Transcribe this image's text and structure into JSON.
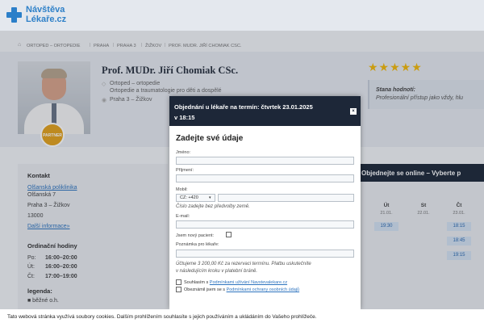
{
  "header": {
    "logo_line1": "Návštěva",
    "logo_line2": "Lékaře.cz"
  },
  "breadcrumb": [
    "ORTOPED – ORTOPEDIE",
    "PRAHA",
    "PRAHA 3",
    "ŽIŽKOV",
    "PROF. MUDR. JIŘÍ CHOMIAK CSC."
  ],
  "profile": {
    "name": "Prof. MUDr. Jiří Chomiak CSc.",
    "specialty1": "Ortoped – ortopedie",
    "specialty2": "Ortopedie a traumatologie pro děti a dospělé",
    "location": "Praha 3 – Žižkov",
    "badge": "PARTNER",
    "stars": "★★★★★",
    "review_title": "Stana hodnotí:",
    "review_text": "Profesionální přístup jako vždy, hlu"
  },
  "contact": {
    "heading": "Kontakt",
    "clinic_link": "Olšanská poliklinika",
    "street": "Olšanská 7",
    "city": "Praha 3 – Žižkov",
    "zip": "13000",
    "more_link": "Další informace»",
    "hours_heading": "Ordinační hodiny",
    "hours": [
      {
        "day": "Po:",
        "time": "16:00–20:00"
      },
      {
        "day": "Út:",
        "time": "16:00–20:00"
      },
      {
        "day": "Čt:",
        "time": "17:00–19:00"
      }
    ],
    "legend_heading": "legenda:",
    "legend_item": "■ běžné o.h."
  },
  "booking": {
    "heading": "Objednejte se online – Vyberte p",
    "days": [
      {
        "name": "Út",
        "date": "21.01."
      },
      {
        "name": "St",
        "date": "22.01."
      },
      {
        "name": "Čt",
        "date": "23.01."
      }
    ],
    "slots_day1": [
      "19:30"
    ],
    "slots_day3": [
      "18:15",
      "18:45",
      "19:15"
    ]
  },
  "modal": {
    "title_line1": "Objednání u lékaře na termín: čtvrtek 23.01.2025",
    "title_line2": "v 18:15",
    "close": "×",
    "form_title": "Zadejte své údaje",
    "label_first": "Jméno:",
    "label_last": "Příjmení:",
    "label_phone": "Mobil:",
    "phone_prefix": "CZ: +420",
    "phone_hint": "Číslo zadejte bez předvolby země.",
    "label_email": "E-mail:",
    "label_new": "Jsem nový pacient:",
    "label_note": "Poznámka pro lékaře:",
    "price_line1": "Účtujeme 3 200,00 Kč za rezervaci termínu. Platbu uskutečníte",
    "price_line2": "v následujícím kroku v platební bráně.",
    "consent1_text": "Souhlasím s",
    "consent1_link": "Podmínkami užívání Navstevalekare.cz",
    "consent2_text": "Obeznámil jsem se s",
    "consent2_link": "Podmínkami ochrany osobních údajů"
  },
  "cookie_bar": "Tato webová stránka využívá soubory cookies. Dalším prohlížením souhlasíte s jejich používáním a ukládáním do Vašeho prohlížeče."
}
